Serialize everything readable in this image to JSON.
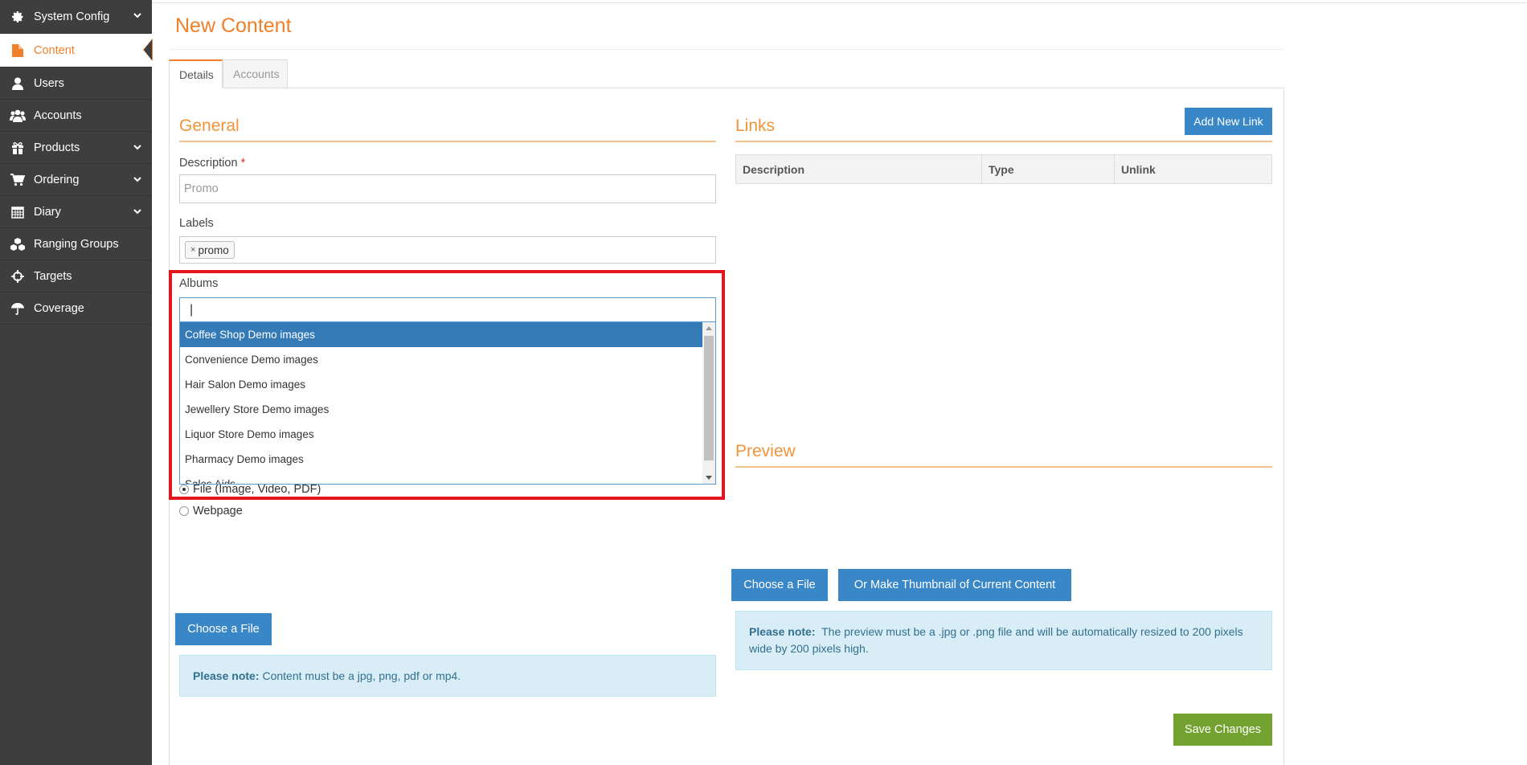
{
  "sidebar": {
    "items": [
      {
        "label": "System Config",
        "icon": "gear-icon",
        "has_chevron": true
      },
      {
        "label": "Content",
        "icon": "file-icon",
        "active": true
      },
      {
        "label": "Users",
        "icon": "user-icon"
      },
      {
        "label": "Accounts",
        "icon": "users-group-icon"
      },
      {
        "label": "Products",
        "icon": "gift-icon",
        "has_chevron": true
      },
      {
        "label": "Ordering",
        "icon": "cart-icon",
        "has_chevron": true
      },
      {
        "label": "Diary",
        "icon": "calendar-icon",
        "has_chevron": true
      },
      {
        "label": "Ranging Groups",
        "icon": "cubes-icon"
      },
      {
        "label": "Targets",
        "icon": "crosshairs-icon"
      },
      {
        "label": "Coverage",
        "icon": "umbrella-icon"
      }
    ]
  },
  "page": {
    "title": "New Content"
  },
  "tabs": [
    {
      "label": "Details",
      "active": true
    },
    {
      "label": "Accounts",
      "active": false
    }
  ],
  "general": {
    "title": "General",
    "description_label": "Description",
    "description_required_mark": "*",
    "description_placeholder": "Promo",
    "labels_label": "Labels",
    "labels": [
      {
        "remove": "×",
        "text": "promo"
      }
    ],
    "albums_label": "Albums",
    "albums_search_value": "|",
    "albums_options": [
      "Coffee Shop Demo images",
      "Convenience Demo images",
      "Hair Salon Demo images",
      "Jewellery Store Demo images",
      "Liquor Store Demo images",
      "Pharmacy Demo images",
      "Sales Aids"
    ],
    "albums_selected_index": 0,
    "content_type_options": [
      {
        "label": "File (Image, Video, PDF)",
        "checked": true
      },
      {
        "label": "Webpage",
        "checked": false
      }
    ],
    "choose_file_label": "Choose a File",
    "note_bold": "Please note:",
    "note_text": "Content must be a jpg, png, pdf or mp4."
  },
  "links": {
    "title": "Links",
    "add_button": "Add New Link",
    "columns": [
      "Description",
      "Type",
      "Unlink"
    ],
    "rows": []
  },
  "preview": {
    "title": "Preview",
    "choose_file_label": "Choose a File",
    "thumbnail_label": "Or Make Thumbnail of Current Content",
    "note_bold": "Please note:",
    "note_text": "The preview must be a .jpg or .png file and will be automatically resized to 200 pixels wide by 200 pixels high."
  },
  "actions": {
    "save_label": "Save Changes"
  },
  "colors": {
    "accent": "#f07f2a",
    "sidebar_bg": "#3e3e3e",
    "primary_button": "#3a87c8",
    "success_button": "#73a230",
    "highlight": "#e3161f",
    "note_bg": "#d9edf7"
  }
}
